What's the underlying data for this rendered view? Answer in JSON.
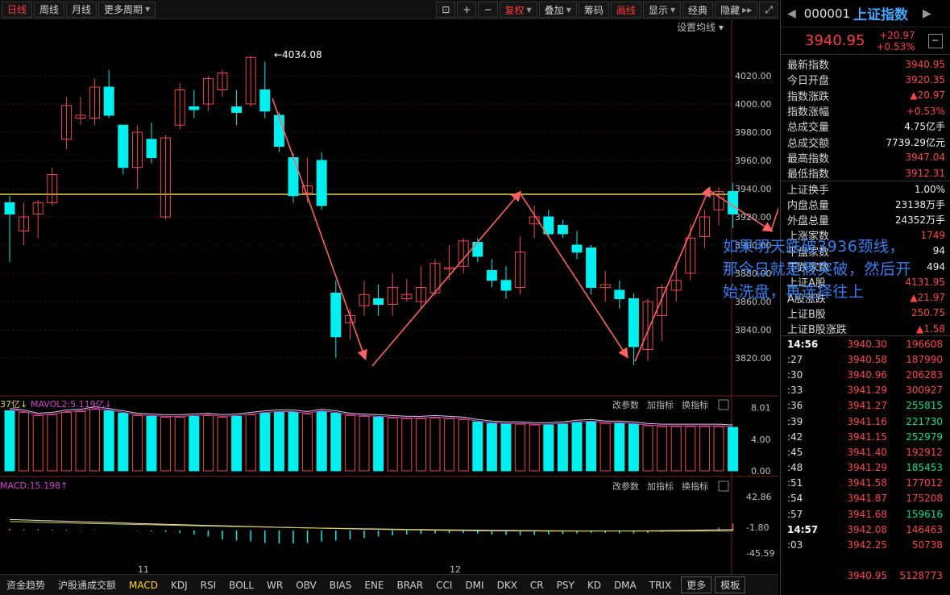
{
  "toolbar": {
    "left_tabs": [
      "日线",
      "周线",
      "月线",
      "更多周期"
    ],
    "active_tab": "日线",
    "right_buttons": [
      "复权",
      "叠加",
      "筹码",
      "画线",
      "显示",
      "经典",
      "隐藏"
    ],
    "setting_label": "设置均线"
  },
  "price_chart": {
    "y_ticks": [
      "4020.00",
      "4000.00",
      "3980.00",
      "3960.00",
      "3940.00",
      "3920.00",
      "3900.00",
      "3880.00",
      "3860.00",
      "3840.00",
      "3820.00"
    ],
    "y_tick_values": [
      4020,
      4000,
      3980,
      3960,
      3940,
      3920,
      3900,
      3880,
      3860,
      3840,
      3820
    ],
    "high_label": "←4034.08",
    "neckline_value": 3936,
    "x_labels": [
      "11",
      "12"
    ],
    "candles": [
      {
        "o": 3930,
        "c": 3922,
        "h": 3935,
        "l": 3888
      },
      {
        "o": 3910,
        "c": 3920,
        "h": 3930,
        "l": 3900
      },
      {
        "o": 3922,
        "c": 3930,
        "h": 3932,
        "l": 3905
      },
      {
        "o": 3930,
        "c": 3950,
        "h": 3955,
        "l": 3928
      },
      {
        "o": 3975,
        "c": 3999,
        "h": 4005,
        "l": 3968
      },
      {
        "o": 3990,
        "c": 3992,
        "h": 4005,
        "l": 3985
      },
      {
        "o": 3990,
        "c": 4012,
        "h": 4018,
        "l": 3985
      },
      {
        "o": 4012,
        "c": 3992,
        "h": 4024,
        "l": 3990
      },
      {
        "o": 3985,
        "c": 3955,
        "h": 3985,
        "l": 3950
      },
      {
        "o": 3955,
        "c": 3980,
        "h": 3985,
        "l": 3940
      },
      {
        "o": 3975,
        "c": 3962,
        "h": 3987,
        "l": 3958
      },
      {
        "o": 3920,
        "c": 3976,
        "h": 3978,
        "l": 3918
      },
      {
        "o": 3985,
        "c": 4010,
        "h": 4015,
        "l": 3982
      },
      {
        "o": 3998,
        "c": 3996,
        "h": 4010,
        "l": 3990
      },
      {
        "o": 4000,
        "c": 4018,
        "h": 4020,
        "l": 3995
      },
      {
        "o": 4010,
        "c": 4022,
        "h": 4024,
        "l": 4005
      },
      {
        "o": 3998,
        "c": 3994,
        "h": 4010,
        "l": 3985
      },
      {
        "o": 4000,
        "c": 4033,
        "h": 4034.08,
        "l": 3998
      },
      {
        "o": 4010,
        "c": 3995,
        "h": 4030,
        "l": 3990
      },
      {
        "o": 3992,
        "c": 3970,
        "h": 3994,
        "l": 3966
      },
      {
        "o": 3962,
        "c": 3935,
        "h": 3965,
        "l": 3930
      },
      {
        "o": 3937,
        "c": 3942,
        "h": 3962,
        "l": 3930
      },
      {
        "o": 3960,
        "c": 3928,
        "h": 3966,
        "l": 3925
      },
      {
        "o": 3866,
        "c": 3835,
        "h": 3875,
        "l": 3820
      },
      {
        "o": 3845,
        "c": 3850,
        "h": 3855,
        "l": 3833
      },
      {
        "o": 3857,
        "c": 3865,
        "h": 3875,
        "l": 3850
      },
      {
        "o": 3862,
        "c": 3858,
        "h": 3872,
        "l": 3850
      },
      {
        "o": 3858,
        "c": 3870,
        "h": 3880,
        "l": 3850
      },
      {
        "o": 3862,
        "c": 3865,
        "h": 3876,
        "l": 3860
      },
      {
        "o": 3860,
        "c": 3870,
        "h": 3885,
        "l": 3855
      },
      {
        "o": 3866,
        "c": 3887,
        "h": 3890,
        "l": 3864
      },
      {
        "o": 3883,
        "c": 3884,
        "h": 3900,
        "l": 3875
      },
      {
        "o": 3885,
        "c": 3903,
        "h": 3905,
        "l": 3880
      },
      {
        "o": 3902,
        "c": 3892,
        "h": 3905,
        "l": 3888
      },
      {
        "o": 3882,
        "c": 3875,
        "h": 3890,
        "l": 3870
      },
      {
        "o": 3875,
        "c": 3868,
        "h": 3885,
        "l": 3862
      },
      {
        "o": 3870,
        "c": 3895,
        "h": 3906,
        "l": 3865
      },
      {
        "o": 3915,
        "c": 3920,
        "h": 3928,
        "l": 3905
      },
      {
        "o": 3920,
        "c": 3908,
        "h": 3925,
        "l": 3905
      },
      {
        "o": 3914,
        "c": 3908,
        "h": 3918,
        "l": 3905
      },
      {
        "o": 3900,
        "c": 3895,
        "h": 3910,
        "l": 3890
      },
      {
        "o": 3898,
        "c": 3870,
        "h": 3900,
        "l": 3865
      },
      {
        "o": 3870,
        "c": 3872,
        "h": 3882,
        "l": 3860
      },
      {
        "o": 3868,
        "c": 3862,
        "h": 3875,
        "l": 3855
      },
      {
        "o": 3862,
        "c": 3828,
        "h": 3866,
        "l": 3815
      },
      {
        "o": 3826,
        "c": 3860,
        "h": 3862,
        "l": 3818
      },
      {
        "o": 3850,
        "c": 3870,
        "h": 3872,
        "l": 3832
      },
      {
        "o": 3868,
        "c": 3875,
        "h": 3888,
        "l": 3860
      },
      {
        "o": 3880,
        "c": 3905,
        "h": 3915,
        "l": 3875
      },
      {
        "o": 3906,
        "c": 3920,
        "h": 3925,
        "l": 3898
      },
      {
        "o": 3925,
        "c": 3938,
        "h": 3941,
        "l": 3914
      },
      {
        "o": 3938,
        "c": 3922,
        "h": 3944,
        "l": 3912
      }
    ]
  },
  "annotation": {
    "text": "如果明天跌破3936颈线，那今日就是假突破，然后开始洗盘，再选择往上"
  },
  "volume_panel": {
    "legend_a": "37亿↓",
    "legend_b": "MAVOL2:5.119亿↓",
    "actions": [
      "改参数",
      "加指标",
      "换指标"
    ],
    "y_ticks": [
      "8.01",
      "4.00",
      "0.00"
    ],
    "y_tick_values": [
      8.01,
      4.0,
      0.0
    ]
  },
  "macd_panel": {
    "legend": "MACD:15.198↑",
    "actions": [
      "改参数",
      "加指标",
      "换指标"
    ],
    "y_ticks": [
      "42.86",
      "-1.80",
      "-45.59"
    ],
    "y_tick_values": [
      42.86,
      -1.8,
      -45.59
    ]
  },
  "bottom_tabs": [
    "资金趋势",
    "沪股通成交额",
    "MACD",
    "KDJ",
    "RSI",
    "BOLL",
    "WR",
    "OBV",
    "BIAS",
    "ENE",
    "BRAR",
    "CCI",
    "DMI",
    "DKX",
    "CR",
    "PSY",
    "KD",
    "DMA",
    "TRIX",
    "更多",
    "模板"
  ],
  "active_bottom_tab": "MACD",
  "right_panel": {
    "code": "000001",
    "name": "上证指数",
    "price": "3940.95",
    "change": "+20.97",
    "change_pct": "+0.53%",
    "stats": [
      {
        "label": "最新指数",
        "value": "3940.95",
        "color": "red"
      },
      {
        "label": "今日开盘",
        "value": "3920.35",
        "color": "red"
      },
      {
        "label": "指数涨跌",
        "value": "▲20.97",
        "color": "red"
      },
      {
        "label": "指数涨幅",
        "value": "+0.53%",
        "color": "red"
      },
      {
        "label": "总成交量",
        "value": "4.75亿手",
        "color": "white"
      },
      {
        "label": "总成交额",
        "value": "7739.29亿元",
        "color": "white"
      },
      {
        "label": "最高指数",
        "value": "3947.04",
        "color": "red"
      },
      {
        "label": "最低指数",
        "value": "3912.31",
        "color": "red"
      },
      {
        "label": "上证换手",
        "value": "1.00%",
        "color": "white"
      },
      {
        "label": "内盘总量",
        "value": "23138万手",
        "color": "white"
      },
      {
        "label": "外盘总量",
        "value": "24352万手",
        "color": "white"
      },
      {
        "label": "上涨家数",
        "value": "1749",
        "color": "red"
      },
      {
        "label": "平盘家数",
        "value": "94",
        "color": "white"
      },
      {
        "label": "下跌家数",
        "value": "494",
        "color": "white"
      },
      {
        "label": "上证A股",
        "value": "4131.95",
        "color": "red"
      },
      {
        "label": "A股涨跌",
        "value": "▲21.97",
        "color": "red"
      },
      {
        "label": "上证B股",
        "value": "250.75",
        "color": "red"
      },
      {
        "label": "上证B股涨跌",
        "value": "▲1.58",
        "color": "red"
      }
    ],
    "ticks": [
      {
        "time": "14:56",
        "price": "3940.30",
        "vol": "196608",
        "vcolor": "red"
      },
      {
        "time": ":27",
        "price": "3940.58",
        "vol": "187990",
        "vcolor": "red"
      },
      {
        "time": ":30",
        "price": "3940.96",
        "vol": "206283",
        "vcolor": "red"
      },
      {
        "time": ":33",
        "price": "3941.29",
        "vol": "300927",
        "vcolor": "red"
      },
      {
        "time": ":36",
        "price": "3941.27",
        "vol": "255815",
        "vcolor": "green"
      },
      {
        "time": ":39",
        "price": "3941.16",
        "vol": "221730",
        "vcolor": "green"
      },
      {
        "time": ":42",
        "price": "3941.15",
        "vol": "252979",
        "vcolor": "green"
      },
      {
        "time": ":45",
        "price": "3941.40",
        "vol": "192912",
        "vcolor": "red"
      },
      {
        "time": ":48",
        "price": "3941.29",
        "vol": "185453",
        "vcolor": "green"
      },
      {
        "time": ":51",
        "price": "3941.58",
        "vol": "177012",
        "vcolor": "red"
      },
      {
        "time": ":54",
        "price": "3941.87",
        "vol": "175208",
        "vcolor": "red"
      },
      {
        "time": ":57",
        "price": "3941.68",
        "vol": "159616",
        "vcolor": "green"
      },
      {
        "time": "14:57",
        "price": "3942.08",
        "vol": "146463",
        "vcolor": "red"
      },
      {
        "time": ":03",
        "price": "3942.25",
        "vol": "50738",
        "vcolor": "red"
      },
      {
        "time": "",
        "price": "",
        "vol": "",
        "vcolor": "red"
      },
      {
        "time": "",
        "price": "3940.95",
        "vol": "5128773",
        "vcolor": "red"
      }
    ]
  },
  "colors": {
    "up": "#f04848",
    "down": "#00f0f0",
    "neckline": "#e8d24a",
    "arrow": "#ff6060",
    "annotation": "#2f7ff2"
  }
}
